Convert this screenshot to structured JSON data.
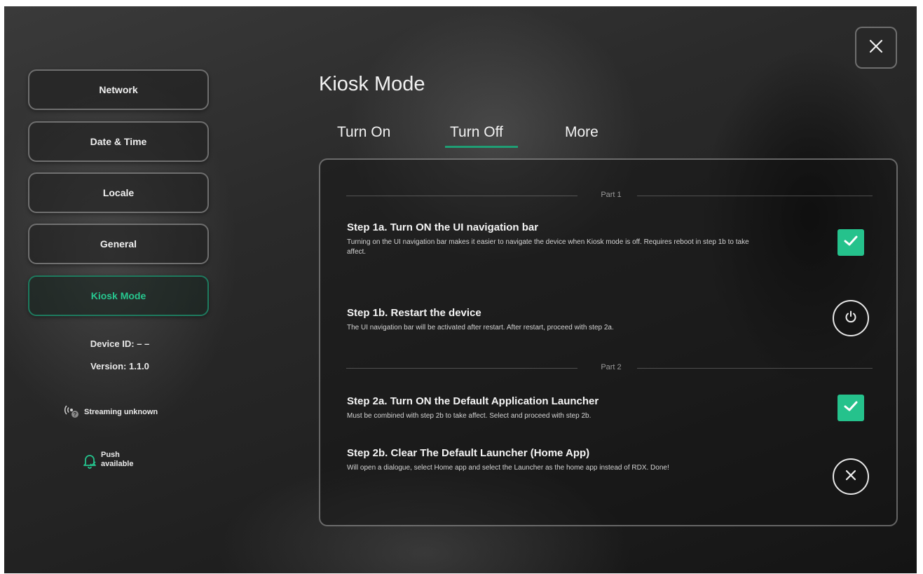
{
  "sidebar": {
    "items": [
      {
        "label": "Network"
      },
      {
        "label": "Date & Time"
      },
      {
        "label": "Locale"
      },
      {
        "label": "General"
      },
      {
        "label": "Kiosk Mode",
        "active": true
      }
    ],
    "device_id_label": "Device ID:",
    "device_id_value": "– –",
    "version_label": "Version:",
    "version_value": "1.1.0",
    "streaming_status": "Streaming unknown",
    "push_line1": "Push",
    "push_line2": "available"
  },
  "header": {
    "title": "Kiosk Mode",
    "close_icon": "close-icon"
  },
  "tabs": [
    {
      "label": "Turn On"
    },
    {
      "label": "Turn Off",
      "active": true
    },
    {
      "label": "More"
    }
  ],
  "panel": {
    "part1_label": "Part 1",
    "part2_label": "Part 2",
    "steps": [
      {
        "title": "Step 1a. Turn ON the UI navigation bar",
        "description": "Turning on the UI navigation bar makes it easier to navigate the device when Kiosk mode is off. Requires reboot in step 1b to take affect.",
        "control": "checkbox",
        "checked": true
      },
      {
        "title": "Step 1b. Restart the device",
        "description": "The UI navigation bar will be activated after restart. After restart, proceed with step 2a.",
        "control": "power-icon"
      },
      {
        "title": "Step 2a. Turn ON the Default Application Launcher",
        "description": "Must be combined with step 2b to take affect. Select and proceed with step 2b.",
        "control": "checkbox",
        "checked": true
      },
      {
        "title": "Step 2b. Clear The Default Launcher (Home App)",
        "description": "Will open a dialogue, select Home app and select the Launcher as the home app instead of RDX. Done!",
        "control": "close-icon"
      }
    ]
  },
  "colors": {
    "accent": "#25c28c",
    "accent_dark": "#1f9e74",
    "active_border": "#1e7a5e"
  }
}
